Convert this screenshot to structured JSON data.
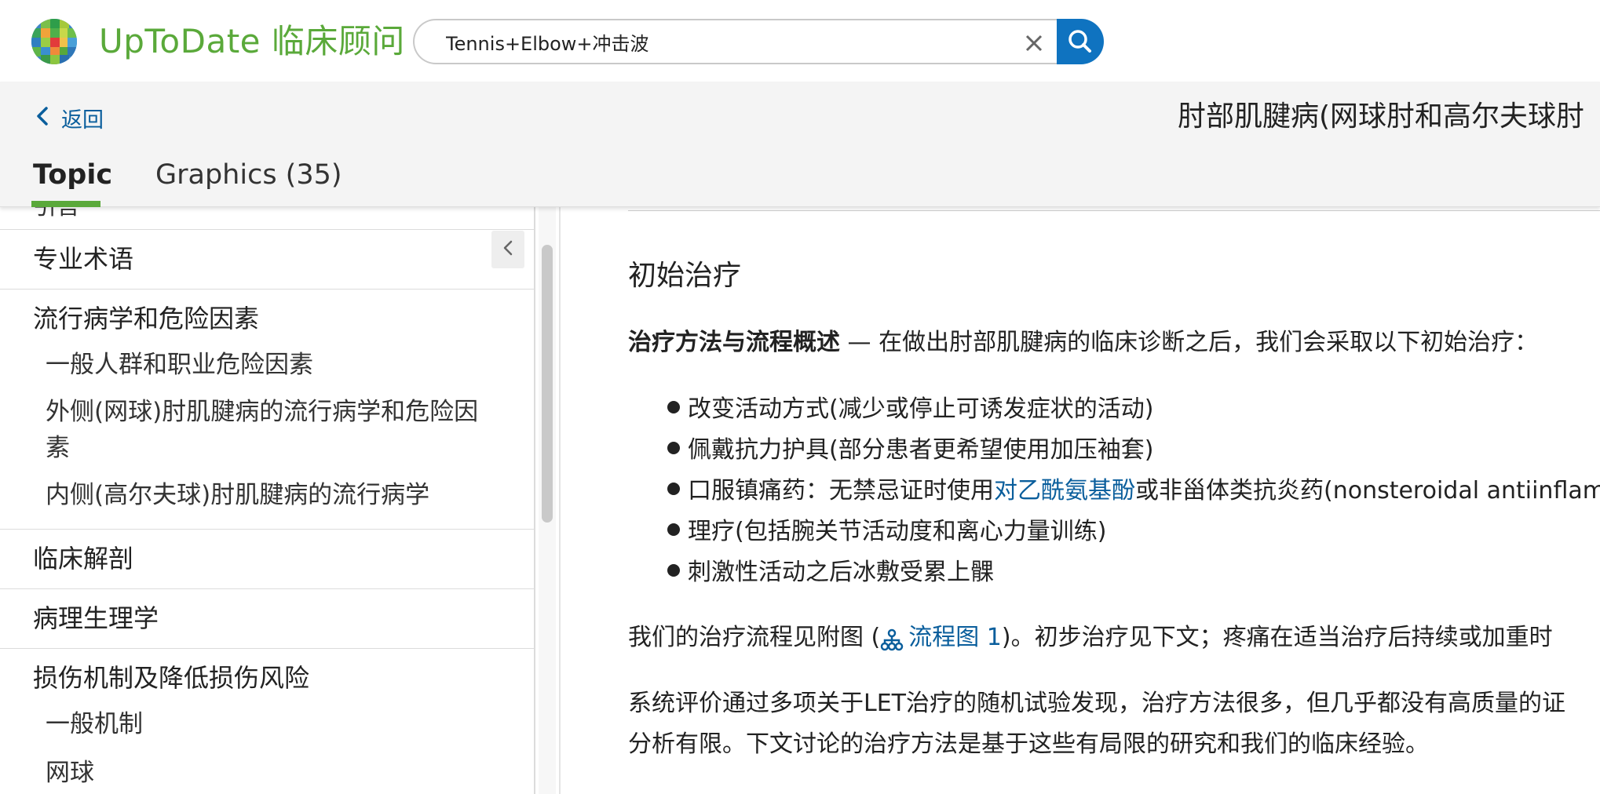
{
  "header": {
    "logo_text": "UpToDate 临床顾问",
    "search": {
      "value": "Tennis+Elbow+冲击波"
    },
    "icons": {
      "clear": "close-icon",
      "search": "search-icon"
    },
    "colors": {
      "brand_green": "#5aa93a",
      "search_blue": "#0f73c0"
    }
  },
  "topbar": {
    "back_label": "返回",
    "topic_title": "肘部肌腱病(网球肘和高尔夫球肘",
    "tabs": [
      {
        "label": "Topic",
        "active": true
      },
      {
        "label": "Graphics (35)",
        "active": false
      }
    ]
  },
  "sidebar": {
    "partial_item": "引言",
    "items": [
      {
        "label": "专业术语"
      },
      {
        "label": "流行病学和危险因素",
        "children": [
          "一般人群和职业危险因素",
          "外侧(网球)肘肌腱病的流行病学和危险因素",
          "内侧(高尔夫球)肘肌腱病的流行病学"
        ]
      },
      {
        "label": "临床解剖"
      },
      {
        "label": "病理生理学"
      },
      {
        "label": "损伤机制及降低损伤风险",
        "children": [
          "一般机制",
          "网球"
        ]
      }
    ]
  },
  "main": {
    "heading": "初始治疗",
    "overview_bold": "治疗方法与流程概述",
    "overview_rest": " — 在做出肘部肌腱病的临床诊断之后，我们会采取以下初始治疗：",
    "bullets": [
      {
        "text": "改变活动方式(减少或停止可诱发症状的活动)"
      },
      {
        "text": "佩戴抗力护具(部分患者更希望使用加压袖套)"
      },
      {
        "pre": "口服镇痛药：无禁忌证时使用",
        "link": "对乙酰氨基酚",
        "post": "或非甾体类抗炎药(nonsteroidal antiinflammatory"
      },
      {
        "text": "理疗(包括腕关节活动度和离心力量训练)"
      },
      {
        "text": "刺激性活动之后冰敷受累上髁"
      }
    ],
    "flow_pre": "我们的治疗流程见附图 (",
    "flow_link": "流程图 1",
    "flow_post": ")。初步治疗见下文；疼痛在适当治疗后持续或加重时",
    "review_line1": "系统评价通过多项关于LET治疗的随机试验发现，治疗方法很多，但几乎都没有高质量的证",
    "review_line2": "分析有限。下文讨论的治疗方法是基于这些有局限的研究和我们的临床经验。",
    "link_color": "#0a5e9c"
  }
}
